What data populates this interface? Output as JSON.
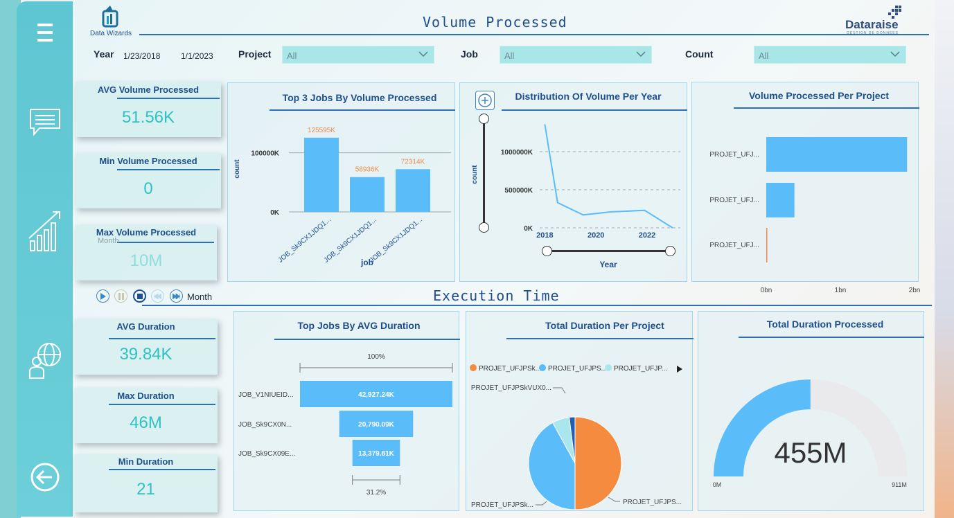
{
  "header": {
    "title": "Volume Processed",
    "brand_left": "Data Wizards",
    "brand_right": "Dataraise",
    "brand_right_tagline": "GESTION DE DONNEES"
  },
  "filters": {
    "year_label": "Year",
    "year_from": "1/23/2018",
    "year_to": "1/1/2023",
    "project_label": "Project",
    "project_value": "All",
    "job_label": "Job",
    "job_value": "All",
    "count_label": "Count",
    "count_value": "All"
  },
  "volume_kpis": [
    {
      "label": "AVG Volume Processed",
      "value": "51.56K"
    },
    {
      "label": "Min Volume Processed",
      "value": "0"
    },
    {
      "label": "Max Volume Processed",
      "value": "10M",
      "overlay": "Month"
    }
  ],
  "section2": {
    "title": "Execution Time",
    "play_label": "Month"
  },
  "duration_kpis": [
    {
      "label": "AVG Duration",
      "value": "39.84K"
    },
    {
      "label": "Max Duration",
      "value": "46M"
    },
    {
      "label": "Min Duration",
      "value": "21"
    }
  ],
  "chart_data": [
    {
      "type": "bar",
      "title": "Top 3 Jobs By Volume Processed",
      "xlabel": "job",
      "ylabel": "count",
      "categories": [
        "JOB_Sk9CX1JDQ1...",
        "JOB_Sk9CX1JDQ1...",
        "JOB_Sk9CX1JDQ1..."
      ],
      "values": [
        125595,
        58936,
        72314
      ],
      "data_labels": [
        "125595K",
        "58936K",
        "72314K"
      ],
      "yticks": [
        "0K",
        "100000K"
      ],
      "ylim": [
        0,
        150000
      ],
      "color": "#5bbcfa",
      "label_color": "#f0894a"
    },
    {
      "type": "line",
      "title": "Distribution Of Volume Per Year",
      "xlabel": "Year",
      "ylabel": "count",
      "x": [
        2018.0,
        2018.5,
        2019.5,
        2020.6,
        2021.9,
        2023.0
      ],
      "y": [
        1360000,
        330000,
        170000,
        210000,
        230000,
        0
      ],
      "xticks": [
        "2018",
        "2020",
        "2022"
      ],
      "yticks": [
        "0K",
        "500000K",
        "1000000K"
      ],
      "ylim": [
        0,
        1400000
      ],
      "xlim": [
        2017.8,
        2023.3
      ],
      "color": "#5bbcfa"
    },
    {
      "type": "bar",
      "orientation": "horizontal",
      "title": "Volume Processed Per Project",
      "categories": [
        "PROJET_UFJ...",
        "PROJET_UFJ...",
        "PROJET_UFJ..."
      ],
      "values": [
        1.9,
        0.38,
        0.01
      ],
      "xticks": [
        "0bn",
        "1bn",
        "2bn"
      ],
      "xlim": [
        0,
        2
      ],
      "colors": [
        "#5bbcfa",
        "#5bbcfa",
        "#f0894a"
      ]
    },
    {
      "type": "funnel",
      "title": "Top Jobs By AVG Duration",
      "categories": [
        "JOB_V1NIUEID...",
        "JOB_Sk9CX0N...",
        "JOB_Sk9CX09E..."
      ],
      "values": [
        42927.24,
        20790.09,
        13379.81
      ],
      "data_labels": [
        "42,927.24K",
        "20,790.09K",
        "13,379.81K"
      ],
      "top_pct": "100%",
      "bottom_pct": "31.2%",
      "color": "#5bbcfa"
    },
    {
      "type": "pie",
      "title": "Total Duration Per Project",
      "legend": [
        "PROJET_UFJPSk...",
        "PROJET_UFJPS...",
        "PROJET_UFJP..."
      ],
      "slice_labels": [
        "PROJET_UFJPS...",
        "PROJET_UFJPSk...",
        "PROJET_UFJPSkVUX0..."
      ],
      "values": [
        50,
        42,
        6,
        2
      ],
      "colors": [
        "#f58b3e",
        "#5bbcfa",
        "#a9e6ee",
        "#1f5fb4"
      ]
    },
    {
      "type": "gauge",
      "title": "Total Duration Processed",
      "value": 455,
      "min": 0,
      "max": 911,
      "value_label": "455M",
      "min_label": "0M",
      "max_label": "911M",
      "color": "#5bbcfa",
      "track": "#eaeaec"
    }
  ]
}
